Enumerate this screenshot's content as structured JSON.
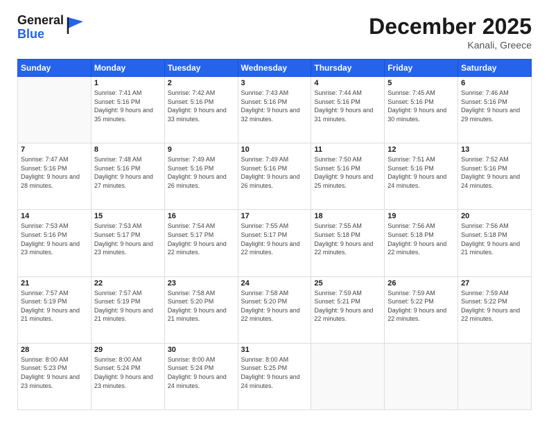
{
  "header": {
    "logo_general": "General",
    "logo_blue": "Blue",
    "month_title": "December 2025",
    "location": "Kanali, Greece"
  },
  "weekdays": [
    "Sunday",
    "Monday",
    "Tuesday",
    "Wednesday",
    "Thursday",
    "Friday",
    "Saturday"
  ],
  "weeks": [
    [
      {
        "day": "",
        "sunrise": "",
        "sunset": "",
        "daylight": ""
      },
      {
        "day": "1",
        "sunrise": "Sunrise: 7:41 AM",
        "sunset": "Sunset: 5:16 PM",
        "daylight": "Daylight: 9 hours and 35 minutes."
      },
      {
        "day": "2",
        "sunrise": "Sunrise: 7:42 AM",
        "sunset": "Sunset: 5:16 PM",
        "daylight": "Daylight: 9 hours and 33 minutes."
      },
      {
        "day": "3",
        "sunrise": "Sunrise: 7:43 AM",
        "sunset": "Sunset: 5:16 PM",
        "daylight": "Daylight: 9 hours and 32 minutes."
      },
      {
        "day": "4",
        "sunrise": "Sunrise: 7:44 AM",
        "sunset": "Sunset: 5:16 PM",
        "daylight": "Daylight: 9 hours and 31 minutes."
      },
      {
        "day": "5",
        "sunrise": "Sunrise: 7:45 AM",
        "sunset": "Sunset: 5:16 PM",
        "daylight": "Daylight: 9 hours and 30 minutes."
      },
      {
        "day": "6",
        "sunrise": "Sunrise: 7:46 AM",
        "sunset": "Sunset: 5:16 PM",
        "daylight": "Daylight: 9 hours and 29 minutes."
      }
    ],
    [
      {
        "day": "7",
        "sunrise": "Sunrise: 7:47 AM",
        "sunset": "Sunset: 5:16 PM",
        "daylight": "Daylight: 9 hours and 28 minutes."
      },
      {
        "day": "8",
        "sunrise": "Sunrise: 7:48 AM",
        "sunset": "Sunset: 5:16 PM",
        "daylight": "Daylight: 9 hours and 27 minutes."
      },
      {
        "day": "9",
        "sunrise": "Sunrise: 7:49 AM",
        "sunset": "Sunset: 5:16 PM",
        "daylight": "Daylight: 9 hours and 26 minutes."
      },
      {
        "day": "10",
        "sunrise": "Sunrise: 7:49 AM",
        "sunset": "Sunset: 5:16 PM",
        "daylight": "Daylight: 9 hours and 26 minutes."
      },
      {
        "day": "11",
        "sunrise": "Sunrise: 7:50 AM",
        "sunset": "Sunset: 5:16 PM",
        "daylight": "Daylight: 9 hours and 25 minutes."
      },
      {
        "day": "12",
        "sunrise": "Sunrise: 7:51 AM",
        "sunset": "Sunset: 5:16 PM",
        "daylight": "Daylight: 9 hours and 24 minutes."
      },
      {
        "day": "13",
        "sunrise": "Sunrise: 7:52 AM",
        "sunset": "Sunset: 5:16 PM",
        "daylight": "Daylight: 9 hours and 24 minutes."
      }
    ],
    [
      {
        "day": "14",
        "sunrise": "Sunrise: 7:53 AM",
        "sunset": "Sunset: 5:16 PM",
        "daylight": "Daylight: 9 hours and 23 minutes."
      },
      {
        "day": "15",
        "sunrise": "Sunrise: 7:53 AM",
        "sunset": "Sunset: 5:17 PM",
        "daylight": "Daylight: 9 hours and 23 minutes."
      },
      {
        "day": "16",
        "sunrise": "Sunrise: 7:54 AM",
        "sunset": "Sunset: 5:17 PM",
        "daylight": "Daylight: 9 hours and 22 minutes."
      },
      {
        "day": "17",
        "sunrise": "Sunrise: 7:55 AM",
        "sunset": "Sunset: 5:17 PM",
        "daylight": "Daylight: 9 hours and 22 minutes."
      },
      {
        "day": "18",
        "sunrise": "Sunrise: 7:55 AM",
        "sunset": "Sunset: 5:18 PM",
        "daylight": "Daylight: 9 hours and 22 minutes."
      },
      {
        "day": "19",
        "sunrise": "Sunrise: 7:56 AM",
        "sunset": "Sunset: 5:18 PM",
        "daylight": "Daylight: 9 hours and 22 minutes."
      },
      {
        "day": "20",
        "sunrise": "Sunrise: 7:56 AM",
        "sunset": "Sunset: 5:18 PM",
        "daylight": "Daylight: 9 hours and 21 minutes."
      }
    ],
    [
      {
        "day": "21",
        "sunrise": "Sunrise: 7:57 AM",
        "sunset": "Sunset: 5:19 PM",
        "daylight": "Daylight: 9 hours and 21 minutes."
      },
      {
        "day": "22",
        "sunrise": "Sunrise: 7:57 AM",
        "sunset": "Sunset: 5:19 PM",
        "daylight": "Daylight: 9 hours and 21 minutes."
      },
      {
        "day": "23",
        "sunrise": "Sunrise: 7:58 AM",
        "sunset": "Sunset: 5:20 PM",
        "daylight": "Daylight: 9 hours and 21 minutes."
      },
      {
        "day": "24",
        "sunrise": "Sunrise: 7:58 AM",
        "sunset": "Sunset: 5:20 PM",
        "daylight": "Daylight: 9 hours and 22 minutes."
      },
      {
        "day": "25",
        "sunrise": "Sunrise: 7:59 AM",
        "sunset": "Sunset: 5:21 PM",
        "daylight": "Daylight: 9 hours and 22 minutes."
      },
      {
        "day": "26",
        "sunrise": "Sunrise: 7:59 AM",
        "sunset": "Sunset: 5:22 PM",
        "daylight": "Daylight: 9 hours and 22 minutes."
      },
      {
        "day": "27",
        "sunrise": "Sunrise: 7:59 AM",
        "sunset": "Sunset: 5:22 PM",
        "daylight": "Daylight: 9 hours and 22 minutes."
      }
    ],
    [
      {
        "day": "28",
        "sunrise": "Sunrise: 8:00 AM",
        "sunset": "Sunset: 5:23 PM",
        "daylight": "Daylight: 9 hours and 23 minutes."
      },
      {
        "day": "29",
        "sunrise": "Sunrise: 8:00 AM",
        "sunset": "Sunset: 5:24 PM",
        "daylight": "Daylight: 9 hours and 23 minutes."
      },
      {
        "day": "30",
        "sunrise": "Sunrise: 8:00 AM",
        "sunset": "Sunset: 5:24 PM",
        "daylight": "Daylight: 9 hours and 24 minutes."
      },
      {
        "day": "31",
        "sunrise": "Sunrise: 8:00 AM",
        "sunset": "Sunset: 5:25 PM",
        "daylight": "Daylight: 9 hours and 24 minutes."
      },
      {
        "day": "",
        "sunrise": "",
        "sunset": "",
        "daylight": ""
      },
      {
        "day": "",
        "sunrise": "",
        "sunset": "",
        "daylight": ""
      },
      {
        "day": "",
        "sunrise": "",
        "sunset": "",
        "daylight": ""
      }
    ]
  ]
}
